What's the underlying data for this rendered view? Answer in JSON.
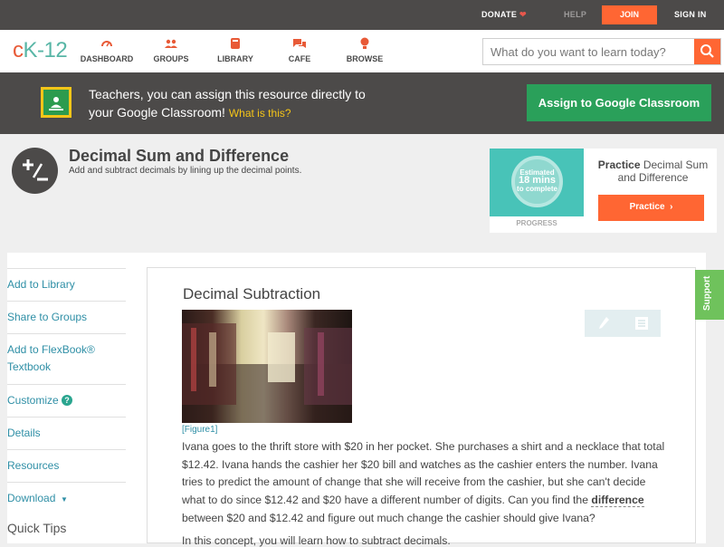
{
  "topbar": {
    "donate": "DONATE",
    "help": "HELP",
    "join": "JOIN",
    "signin": "SIGN IN"
  },
  "logo": {
    "c": "c",
    "k": "K",
    "dash": "-",
    "num": "12"
  },
  "nav": {
    "items": [
      {
        "label": "DASHBOARD",
        "icon": "dashboard-icon"
      },
      {
        "label": "GROUPS",
        "icon": "groups-icon"
      },
      {
        "label": "LIBRARY",
        "icon": "library-icon"
      },
      {
        "label": "CAFE",
        "icon": "cafe-icon"
      },
      {
        "label": "BROWSE",
        "icon": "browse-icon"
      }
    ]
  },
  "search": {
    "placeholder": "What do you want to learn today?"
  },
  "banner": {
    "text_line1": "Teachers, you can assign this resource directly to",
    "text_line2": "your Google Classroom!",
    "what_is_this": "What is this?",
    "assign_button": "Assign to Google Classroom"
  },
  "concept": {
    "title": "Decimal Sum and Difference",
    "subtitle": "Add and subtract decimals by lining up the decimal points."
  },
  "practice": {
    "estimated": "Estimated",
    "mins": "18 mins",
    "to_complete": "to complete",
    "progress_label": "PROGRESS",
    "heading_bold": "Practice",
    "heading_rest": "Decimal Sum and Difference",
    "button": "Practice"
  },
  "sidebar": {
    "items": [
      {
        "label": "Add to Library"
      },
      {
        "label": "Share to Groups"
      },
      {
        "label": "Add to FlexBook®"
      },
      {
        "label": "Textbook"
      },
      {
        "label": "Customize"
      },
      {
        "label": "Details"
      },
      {
        "label": "Resources"
      },
      {
        "label": "Download"
      }
    ],
    "quick_tips": "Quick Tips"
  },
  "lesson": {
    "title": "Decimal Subtraction",
    "figure_link": "[Figure1]",
    "para1_a": "Ivana goes to the thrift store with $20 in her pocket. She purchases a shirt and a necklace that total $12.42. Ivana hands the cashier her $20 bill and watches as the cashier enters the number. Ivana tries to predict the amount of change that she will receive from the cashier, but she can't decide what to do since $12.42 and $20 have a different number of digits. Can you find the ",
    "para1_vocab": "difference",
    "para1_b": " between $20 and $12.42 and figure out much change the cashier should give Ivana?",
    "intro": "In this concept, you will learn how to subtract decimals."
  },
  "support": {
    "label": "Support"
  },
  "colors": {
    "accent_orange": "#ff6633",
    "dark_bar": "#4c4a49",
    "google_green": "#2aa05a",
    "link_teal": "#2f8fa6",
    "support_green": "#6fc25c"
  }
}
